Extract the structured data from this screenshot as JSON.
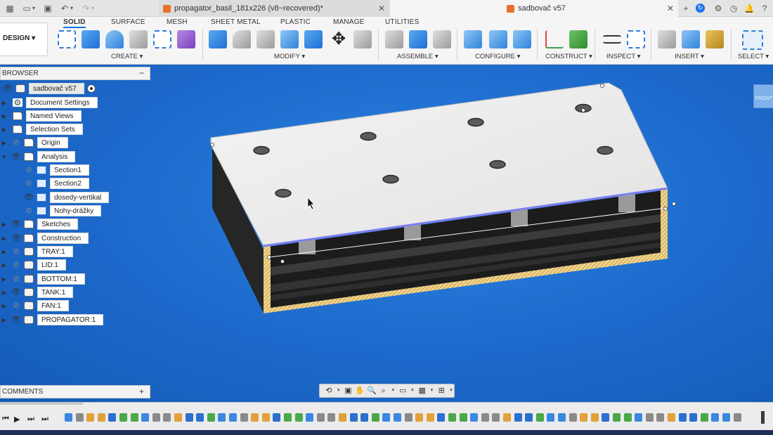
{
  "tabs": [
    {
      "title": "propagator_basil_181x226 (v8~recovered)*"
    },
    {
      "title": "sadbovač v57"
    }
  ],
  "ribbon": {
    "design_label": "DESIGN ▾",
    "tabs": [
      "SOLID",
      "SURFACE",
      "MESH",
      "SHEET METAL",
      "PLASTIC",
      "MANAGE",
      "UTILITIES"
    ],
    "groups": [
      "CREATE ▾",
      "MODIFY ▾",
      "ASSEMBLE ▾",
      "CONFIGURE ▾",
      "CONSTRUCT ▾",
      "INSPECT ▾",
      "INSERT ▾",
      "SELECT ▾"
    ]
  },
  "browser": {
    "title": "BROWSER",
    "root": "sadbovač v57",
    "items": [
      {
        "label": "Document Settings"
      },
      {
        "label": "Named Views"
      },
      {
        "label": "Selection Sets"
      },
      {
        "label": "Origin"
      },
      {
        "label": "Analysis"
      },
      {
        "label": "Section1"
      },
      {
        "label": "Section2"
      },
      {
        "label": "dosedy-vertikal"
      },
      {
        "label": "Nohy-drážky"
      },
      {
        "label": "Sketches"
      },
      {
        "label": "Construction"
      },
      {
        "label": "TRAY:1"
      },
      {
        "label": "LID:1"
      },
      {
        "label": "BOTTOM:1"
      },
      {
        "label": "TANK:1"
      },
      {
        "label": "FAN:1"
      },
      {
        "label": "PROPAGATOR:1"
      }
    ]
  },
  "comments": {
    "title": "COMMENTS"
  },
  "viewcube": {
    "label": "FRONT"
  },
  "colors": {
    "accent": "#1a73e8",
    "viewport": "#1c69cb",
    "lid": "#ebebeb",
    "body": "#2b2b2b",
    "section_hatch": "#e9c77a"
  }
}
